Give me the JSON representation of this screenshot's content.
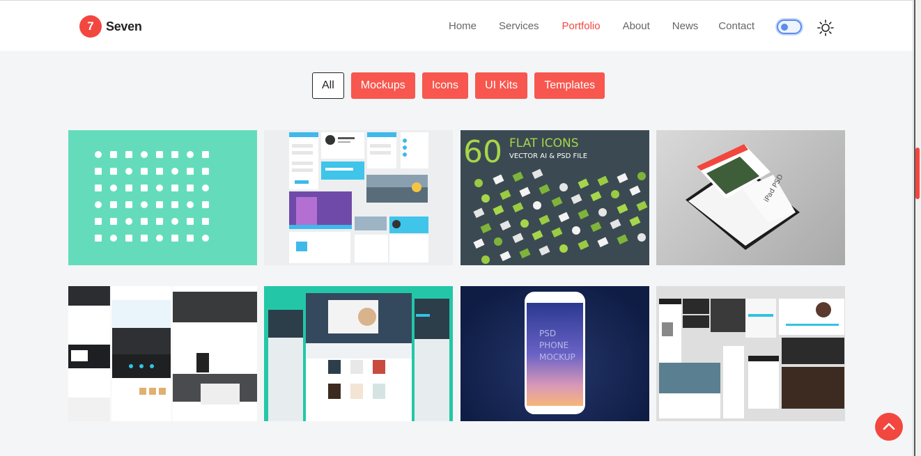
{
  "brand": {
    "badge": "7",
    "name": "Seven"
  },
  "nav": [
    {
      "label": "Home",
      "active": false
    },
    {
      "label": "Services",
      "active": false
    },
    {
      "label": "Portfolio",
      "active": true
    },
    {
      "label": "About",
      "active": false
    },
    {
      "label": "News",
      "active": false
    },
    {
      "label": "Contact",
      "active": false
    }
  ],
  "theme_toggle": {
    "icon": "sun-icon",
    "state": "off"
  },
  "filters": [
    {
      "label": "All",
      "active": true
    },
    {
      "label": "Mockups",
      "active": false
    },
    {
      "label": "Icons",
      "active": false
    },
    {
      "label": "UI Kits",
      "active": false
    },
    {
      "label": "Templates",
      "active": false
    }
  ],
  "portfolio": {
    "items": [
      {
        "name": "icon-set-teal"
      },
      {
        "name": "ui-kit-light"
      },
      {
        "name": "flat-icons",
        "title_number": "60",
        "title_word": "FLAT ICONS",
        "subtitle": "VECTOR AI & PSD FILE"
      },
      {
        "name": "ipad-mockup",
        "screen_label": "iPad PSD"
      },
      {
        "name": "website-template-dark"
      },
      {
        "name": "website-template-teal"
      },
      {
        "name": "phone-mockup",
        "screen_lines": [
          "PSD",
          "PHONE",
          "MOCKUP"
        ]
      },
      {
        "name": "ui-kit-photo"
      }
    ]
  },
  "colors": {
    "accent": "#f2473f",
    "filter_bg": "#f7574e",
    "teal": "#64dcbb",
    "dark_slate": "#3b4a52"
  },
  "back_to_top": {
    "icon": "chevron-up-icon"
  }
}
